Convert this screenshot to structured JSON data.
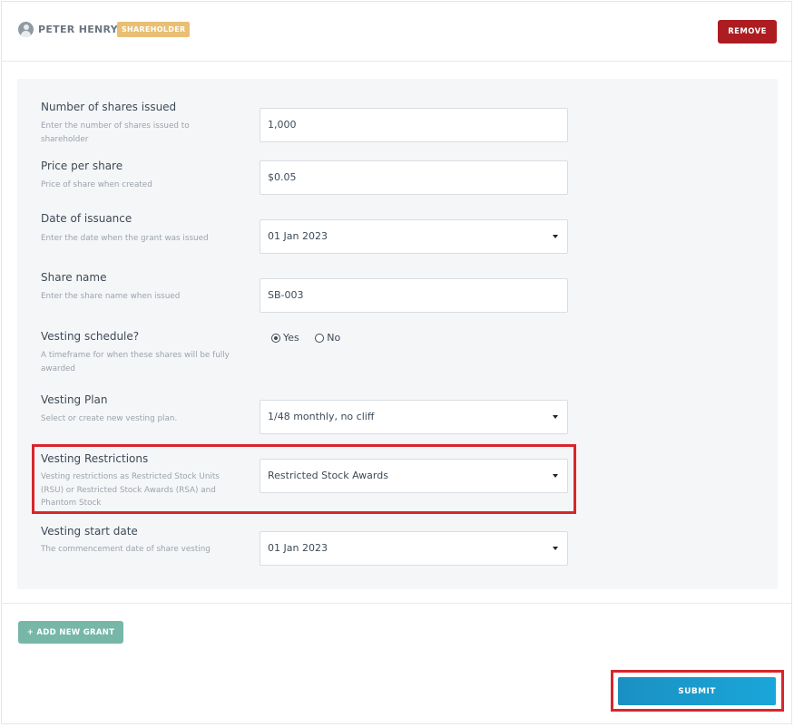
{
  "header": {
    "name": "PETER HENRY",
    "badge": "SHAREHOLDER",
    "remove_label": "REMOVE"
  },
  "form": {
    "shares": {
      "label": "Number of shares issued",
      "help": "Enter the number of shares issued to shareholder",
      "value": "1,000"
    },
    "price": {
      "label": "Price per share",
      "help": "Price of share when created",
      "value": "$0.05"
    },
    "issue_date": {
      "label": "Date of issuance",
      "help": "Enter the date when the grant was issued",
      "value": "01 Jan 2023"
    },
    "share_name": {
      "label": "Share name",
      "help": "Enter the share name when issued",
      "value": "SB-003"
    },
    "vesting_schedule": {
      "label": "Vesting schedule?",
      "help": "A timeframe for when these shares will be fully awarded",
      "options": [
        "Yes",
        "No"
      ],
      "selected": "Yes"
    },
    "vesting_plan": {
      "label": "Vesting Plan",
      "help": "Select or create new vesting plan.",
      "value": "1/48 monthly, no cliff"
    },
    "vesting_restrictions": {
      "label": "Vesting Restrictions",
      "help": "Vesting restrictions as Restricted Stock Units (RSU) or Restricted Stock Awards (RSA) and Phantom Stock",
      "value": "Restricted Stock Awards"
    },
    "vesting_start": {
      "label": "Vesting start date",
      "help": "The commencement date of share vesting",
      "value": "01 Jan 2023"
    }
  },
  "actions": {
    "add_grant_label": "+ ADD NEW GRANT",
    "submit_label": "SUBMIT"
  },
  "colors": {
    "remove": "#ad1c20",
    "badge": "#e9bf73",
    "add_grant": "#76b7a8",
    "submit": "#1aa6d9",
    "highlight": "#d7262d"
  }
}
